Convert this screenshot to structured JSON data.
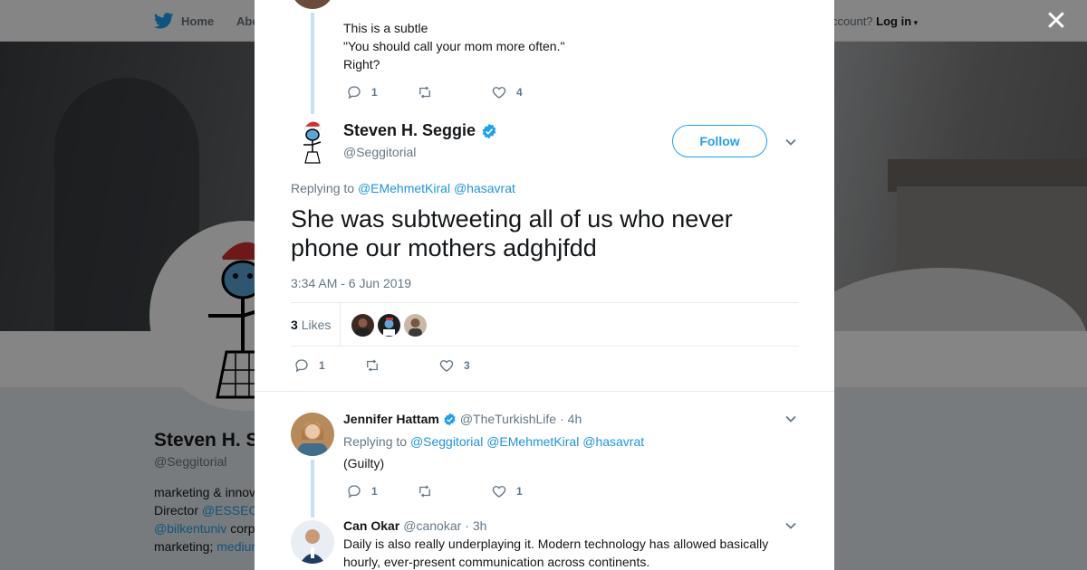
{
  "background": {
    "nav": {
      "home_label": "Home",
      "about_label": "Abo",
      "account_text": "ccount?",
      "login_label": "Log in"
    },
    "profile": {
      "name": "Steven H. S",
      "handle": "@Seggitorial",
      "bio_lines": [
        {
          "text": "marketing & innov",
          "link": ""
        },
        {
          "text": "Director ",
          "link": "@ESSEC"
        },
        {
          "text": "",
          "link": "@bilkentuniv",
          "after": " corp"
        },
        {
          "text": "marketing; ",
          "link": "mediur"
        }
      ]
    }
  },
  "modal": {
    "previous_tweet": {
      "text_lines": [
        "This is a subtle",
        "\"You should call your mom more often.\"",
        "Right?"
      ],
      "reply_count": "1",
      "retweet_count": "",
      "like_count": "4"
    },
    "main_tweet": {
      "author_name": "Steven H. Seggie",
      "author_handle": "@Seggitorial",
      "follow_label": "Follow",
      "replying_prefix": "Replying to ",
      "replying_to": [
        "@EMehmetKiral",
        "@hasavrat"
      ],
      "text": "She was subtweeting all of us who never phone our mothers adghjfdd",
      "timestamp": "3:34 AM - 6 Jun 2019",
      "likes_number": "3",
      "likes_label": "Likes",
      "reply_count": "1",
      "retweet_count": "",
      "like_count": "3"
    },
    "replies": [
      {
        "name": "Jennifer Hattam",
        "handle": "@TheTurkishLife",
        "time": "· 4h",
        "replying_prefix": "Replying to ",
        "replying_to": [
          "@Seggitorial",
          "@EMehmetKiral",
          "@hasavrat"
        ],
        "text": "(Guilty)",
        "reply_count": "1",
        "retweet_count": "",
        "like_count": "1"
      },
      {
        "name": "Can Okar",
        "handle": "@canokar",
        "time": "· 3h",
        "text_lines": [
          "Daily is also really underplaying it. Modern technology has allowed basically",
          "hourly, ever-present communication across continents."
        ]
      }
    ]
  },
  "colors": {
    "accent": "#1da1f2",
    "link": "#1b95e0",
    "thread_line": "#c4e1f5",
    "muted": "#657786"
  },
  "icons": [
    "twitter-bird-icon",
    "close-icon",
    "reply-icon",
    "retweet-icon",
    "heart-icon",
    "verified-badge-icon",
    "chevron-down-icon"
  ]
}
